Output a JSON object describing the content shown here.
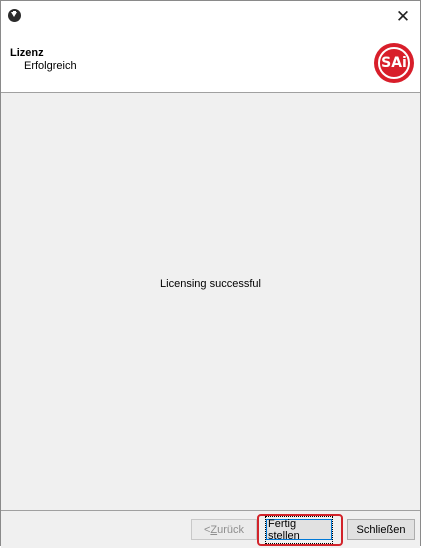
{
  "window": {
    "close_symbol": "✕",
    "app_icon": "download-circle-icon"
  },
  "header": {
    "title": "Lizenz",
    "subtitle": "Erfolgreich",
    "logo_text": "SAi",
    "logo_color": "#d81e2a"
  },
  "content": {
    "message": "Licensing successful"
  },
  "footer": {
    "back_label_prefix": "< ",
    "back_label_underlined": "Z",
    "back_label_rest": "urück",
    "finish_label": "Fertig stellen",
    "close_label": "Schließen",
    "highlight_color": "#d2232a"
  }
}
